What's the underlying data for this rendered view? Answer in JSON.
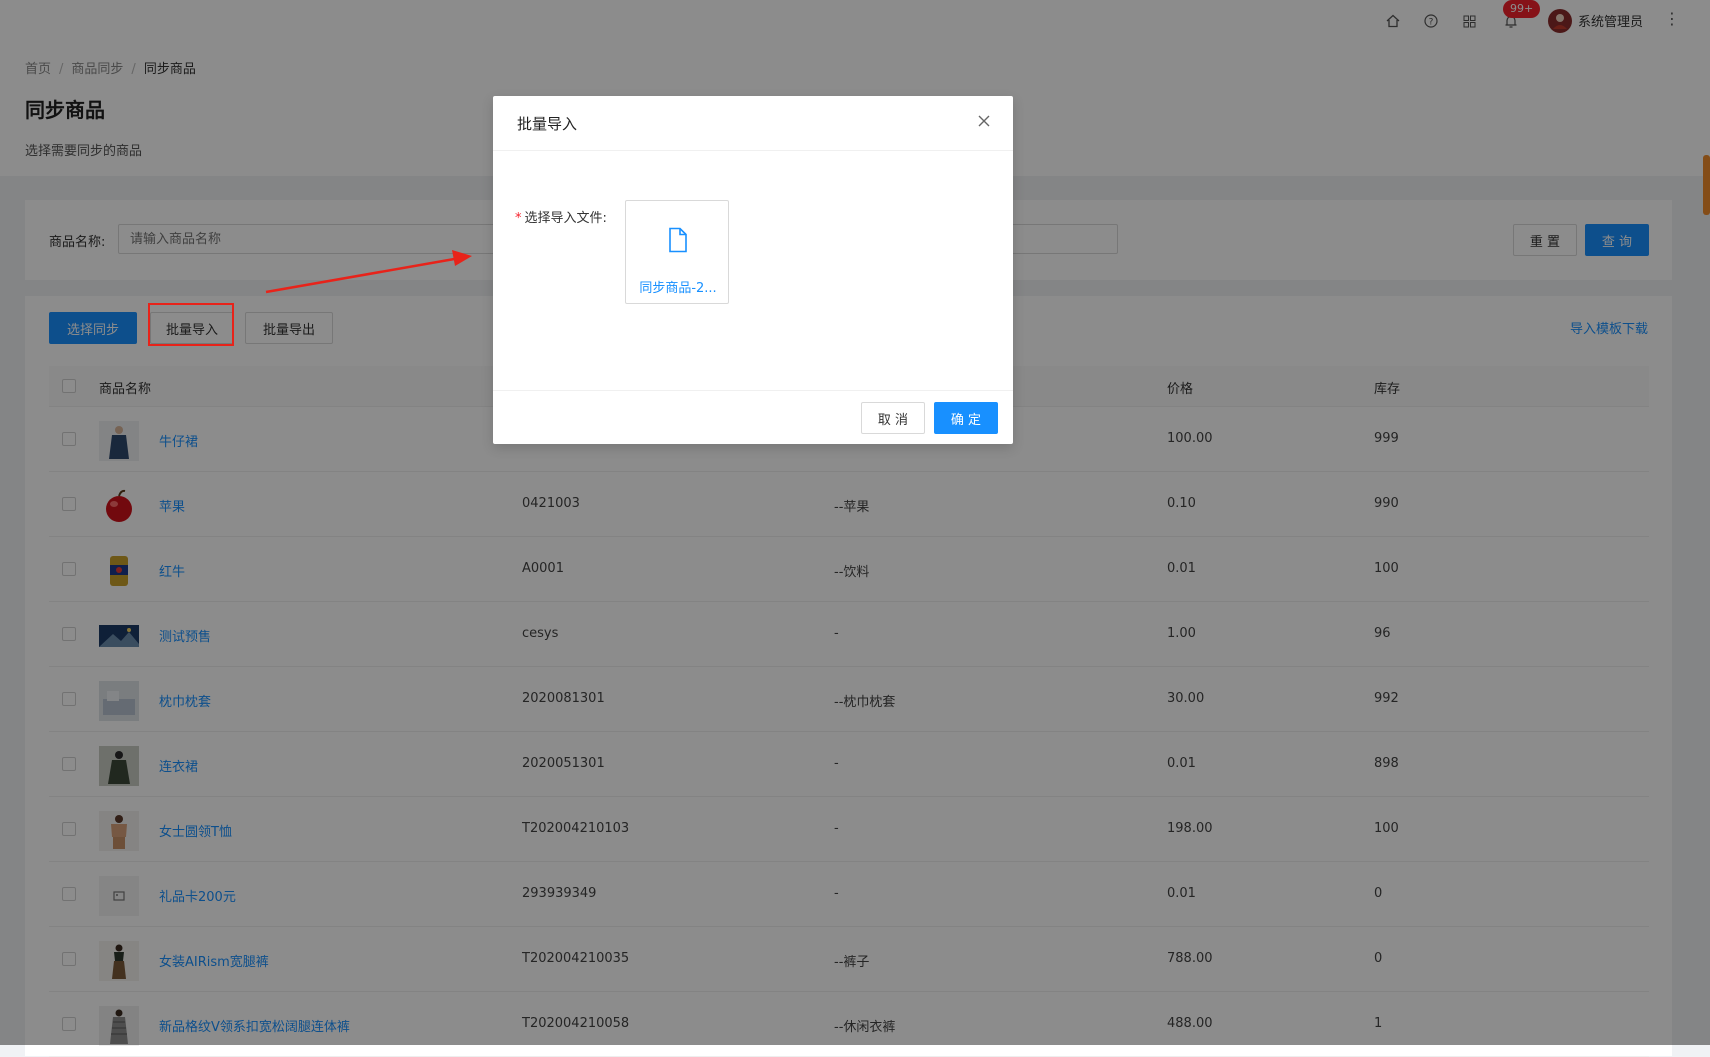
{
  "header": {
    "badge": "99+",
    "username": "系统管理员"
  },
  "breadcrumb": {
    "items": [
      "首页",
      "商品同步",
      "同步商品"
    ]
  },
  "page": {
    "title": "同步商品",
    "description": "选择需要同步的商品"
  },
  "search": {
    "label": "商品名称:",
    "placeholder": "请输入商品名称",
    "reset_label": "重 置",
    "query_label": "查 询"
  },
  "toolbar": {
    "select_sync_label": "选择同步",
    "batch_import_label": "批量导入",
    "batch_export_label": "批量导出",
    "template_download_label": "导入模板下载"
  },
  "table": {
    "columns": [
      "商品名称",
      "价格",
      "库存"
    ],
    "rows": [
      {
        "name": "牛仔裙",
        "code": "",
        "category": "",
        "price": "100.00",
        "stock": "999",
        "thumb": "dress-blue"
      },
      {
        "name": "苹果",
        "code": "0421003",
        "category": "--苹果",
        "price": "0.10",
        "stock": "990",
        "thumb": "apple"
      },
      {
        "name": "红牛",
        "code": "A0001",
        "category": "--饮料",
        "price": "0.01",
        "stock": "100",
        "thumb": "can"
      },
      {
        "name": "测试预售",
        "code": "cesys",
        "category": "-",
        "price": "1.00",
        "stock": "96",
        "thumb": "landscape"
      },
      {
        "name": "枕巾枕套",
        "code": "2020081301",
        "category": "--枕巾枕套",
        "price": "30.00",
        "stock": "992",
        "thumb": "bedding"
      },
      {
        "name": "连衣裙",
        "code": "2020051301",
        "category": "-",
        "price": "0.01",
        "stock": "898",
        "thumb": "dress-dark"
      },
      {
        "name": "女士圆领T恤",
        "code": "T202004210103",
        "category": "-",
        "price": "198.00",
        "stock": "100",
        "thumb": "tshirt"
      },
      {
        "name": "礼品卡200元",
        "code": "293939349",
        "category": "-",
        "price": "0.01",
        "stock": "0",
        "thumb": "placeholder"
      },
      {
        "name": "女装AIRism宽腿裤",
        "code": "T202004210035",
        "category": "--裤子",
        "price": "788.00",
        "stock": "0",
        "thumb": "pants"
      },
      {
        "name": "新品格纹V领系扣宽松阔腿连体裤",
        "code": "T202004210058",
        "category": "--休闲衣裤",
        "price": "488.00",
        "stock": "1",
        "thumb": "jumpsuit"
      }
    ]
  },
  "modal": {
    "title": "批量导入",
    "field_label": "选择导入文件:",
    "required_mark": "*",
    "file_name": "同步商品-2...",
    "cancel_label": "取 消",
    "confirm_label": "确 定"
  },
  "colors": {
    "primary": "#1890ff",
    "annotation": "#e8231a"
  }
}
